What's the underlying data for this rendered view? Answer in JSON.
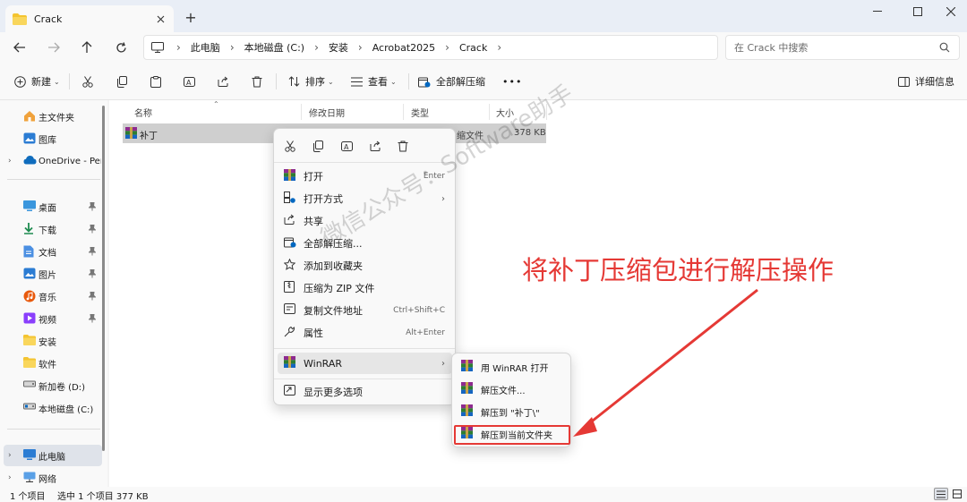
{
  "window": {
    "tab_title": "Crack",
    "new_tab": "+"
  },
  "nav": {
    "breadcrumbs": [
      "此电脑",
      "本地磁盘 (C:)",
      "安装",
      "Acrobat2025",
      "Crack"
    ],
    "search_placeholder": "在 Crack 中搜索"
  },
  "toolbar": {
    "new_label": "新建",
    "sort_label": "排序",
    "view_label": "查看",
    "extract_all_label": "全部解压缩",
    "more_label": "•••",
    "details_label": "详细信息"
  },
  "sidebar": {
    "items": [
      {
        "label": "主文件夹",
        "icon": "home-icon"
      },
      {
        "label": "图库",
        "icon": "gallery-icon"
      },
      {
        "label": "OneDrive - Per",
        "icon": "onedrive-icon"
      },
      {
        "label": "桌面",
        "icon": "desktop-icon"
      },
      {
        "label": "下载",
        "icon": "download-icon"
      },
      {
        "label": "文档",
        "icon": "documents-icon"
      },
      {
        "label": "图片",
        "icon": "pictures-icon"
      },
      {
        "label": "音乐",
        "icon": "music-icon"
      },
      {
        "label": "视频",
        "icon": "videos-icon"
      },
      {
        "label": "安装",
        "icon": "folder-icon"
      },
      {
        "label": "软件",
        "icon": "folder-icon"
      },
      {
        "label": "新加卷 (D:)",
        "icon": "drive-icon"
      },
      {
        "label": "本地磁盘 (C:)",
        "icon": "drive-icon"
      },
      {
        "label": "此电脑",
        "icon": "this-pc-icon"
      },
      {
        "label": "网络",
        "icon": "network-icon"
      }
    ]
  },
  "columns": {
    "name": "名称",
    "modified": "修改日期",
    "type": "类型",
    "size": "大小"
  },
  "files": [
    {
      "name": "补丁",
      "type": "缩文件",
      "size": "378 KB",
      "icon": "winrar-archive-icon"
    }
  ],
  "status": {
    "count": "1 个项目",
    "selected": "选中 1 个项目  377 KB"
  },
  "context_menu": {
    "items": [
      {
        "label": "打开",
        "shortcut": "Enter",
        "icon": "winrar-icon"
      },
      {
        "label": "打开方式",
        "shortcut": "",
        "icon": "open-with-icon"
      },
      {
        "label": "共享",
        "shortcut": "",
        "icon": "share-icon"
      },
      {
        "label": "全部解压缩...",
        "shortcut": "",
        "icon": "extract-icon"
      },
      {
        "label": "添加到收藏夹",
        "shortcut": "",
        "icon": "star-icon"
      },
      {
        "label": "压缩为 ZIP 文件",
        "shortcut": "",
        "icon": "zip-icon"
      },
      {
        "label": "复制文件地址",
        "shortcut": "Ctrl+Shift+C",
        "icon": "copy-path-icon"
      },
      {
        "label": "属性",
        "shortcut": "Alt+Enter",
        "icon": "wrench-icon"
      },
      {
        "label": "WinRAR",
        "shortcut": "",
        "icon": "winrar-icon"
      },
      {
        "label": "显示更多选项",
        "shortcut": "",
        "icon": "more-options-icon"
      }
    ]
  },
  "winrar_submenu": {
    "items": [
      {
        "label": "用 WinRAR 打开"
      },
      {
        "label": "解压文件..."
      },
      {
        "label": "解压到 \"补丁\\\""
      },
      {
        "label": "解压到当前文件夹"
      }
    ]
  },
  "overlay": {
    "watermark": "微信公众号：Software助手",
    "annotation": "将补丁压缩包进行解压操作",
    "annotation_color": "#e53935"
  },
  "colors": {
    "accent": "#0067c0",
    "folder": "#f4c430",
    "highlight_red": "#e53935"
  }
}
